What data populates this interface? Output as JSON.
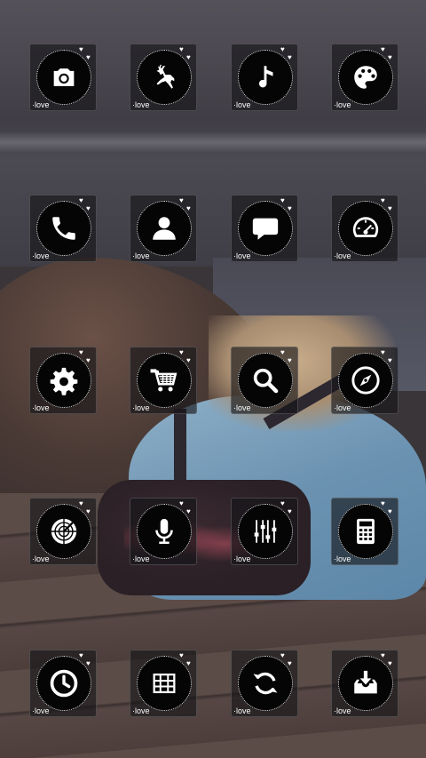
{
  "screen": {
    "caption": "love"
  },
  "icons": [
    {
      "name": "camera-icon",
      "label": "·love"
    },
    {
      "name": "reindeer-icon",
      "label": "·love"
    },
    {
      "name": "music-note-icon",
      "label": "·love"
    },
    {
      "name": "palette-icon",
      "label": "·love"
    },
    {
      "name": "phone-icon",
      "label": "·love"
    },
    {
      "name": "contact-person-icon",
      "label": "·love"
    },
    {
      "name": "message-bubble-icon",
      "label": "·love"
    },
    {
      "name": "speedometer-icon",
      "label": "·love"
    },
    {
      "name": "settings-gear-icon",
      "label": "·love"
    },
    {
      "name": "shopping-cart-icon",
      "label": "·love"
    },
    {
      "name": "search-icon",
      "label": "·love"
    },
    {
      "name": "compass-icon",
      "label": "·love"
    },
    {
      "name": "radar-icon",
      "label": "·love"
    },
    {
      "name": "microphone-icon",
      "label": "·love"
    },
    {
      "name": "equalizer-icon",
      "label": "·love"
    },
    {
      "name": "calculator-icon",
      "label": "·love"
    },
    {
      "name": "clock-icon",
      "label": "·love"
    },
    {
      "name": "grid-widget-icon",
      "label": "·love"
    },
    {
      "name": "sync-icon",
      "label": "·love"
    },
    {
      "name": "download-inbox-icon",
      "label": "·love"
    }
  ],
  "colors": {
    "tile_background": "#141416",
    "circle_background": "#050505",
    "glyph": "#ffffff"
  }
}
